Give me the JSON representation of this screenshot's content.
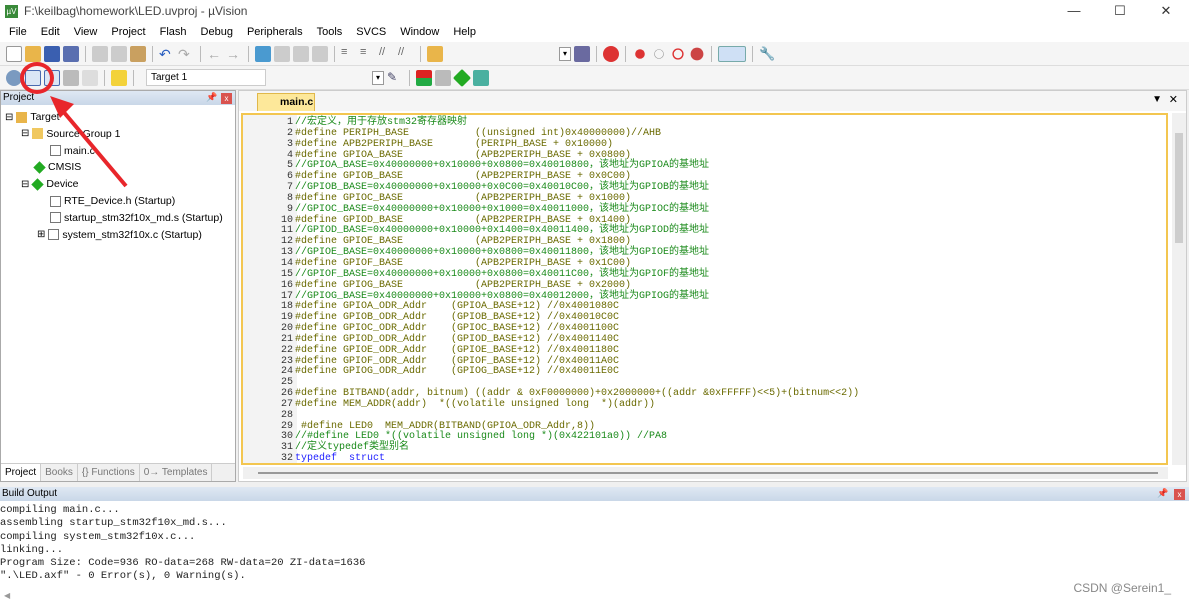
{
  "window": {
    "title": "F:\\keilbag\\homework\\LED.uvproj - µVision",
    "minimize": "—",
    "maximize": "☐",
    "close": "✕"
  },
  "menu": [
    "File",
    "Edit",
    "View",
    "Project",
    "Flash",
    "Debug",
    "Peripherals",
    "Tools",
    "SVCS",
    "Window",
    "Help"
  ],
  "toolbar2": {
    "target": "Target 1"
  },
  "project": {
    "title": "Project",
    "tree": [
      {
        "label": "Target",
        "level": 0,
        "icon": "target-icon"
      },
      {
        "label": "Source Group 1",
        "level": 1,
        "icon": "folder-icon"
      },
      {
        "label": "main.c",
        "level": 2,
        "icon": "file-icon"
      },
      {
        "label": "CMSIS",
        "level": 1,
        "icon": "diamond-icon"
      },
      {
        "label": "Device",
        "level": 1,
        "icon": "diamond-icon"
      },
      {
        "label": "RTE_Device.h (Startup)",
        "level": 2,
        "icon": "file-icon"
      },
      {
        "label": "startup_stm32f10x_md.s (Startup)",
        "level": 2,
        "icon": "file-icon"
      },
      {
        "label": "system_stm32f10x.c (Startup)",
        "level": 2,
        "icon": "file-icon"
      }
    ],
    "tabs": [
      "Project",
      "Books",
      "{} Functions",
      "0→ Templates"
    ]
  },
  "editor": {
    "tab": "main.c",
    "lines": [
      "//宏定义，用于存放stm32寄存器映射",
      "#define PERIPH_BASE           ((unsigned int)0x40000000)//AHB",
      "#define APB2PERIPH_BASE       (PERIPH_BASE + 0x10000)",
      "#define GPIOA_BASE            (APB2PERIPH_BASE + 0x0800)",
      "//GPIOA_BASE=0x40000000+0x10000+0x0800=0x40010800，该地址为GPIOA的基地址",
      "#define GPIOB_BASE            (APB2PERIPH_BASE + 0x0C00)",
      "//GPIOB_BASE=0x40000000+0x10000+0x0C00=0x40010C00，该地址为GPIOB的基地址",
      "#define GPIOC_BASE            (APB2PERIPH_BASE + 0x1000)",
      "//GPIOC_BASE=0x40000000+0x10000+0x1000=0x40011000，该地址为GPIOC的基地址",
      "#define GPIOD_BASE            (APB2PERIPH_BASE + 0x1400)",
      "//GPIOD_BASE=0x40000000+0x10000+0x1400=0x40011400，该地址为GPIOD的基地址",
      "#define GPIOE_BASE            (APB2PERIPH_BASE + 0x1800)",
      "//GPIOE_BASE=0x40000000+0x10000+0x0800=0x40011800，该地址为GPIOE的基地址",
      "#define GPIOF_BASE            (APB2PERIPH_BASE + 0x1C00)",
      "//GPIOF_BASE=0x40000000+0x10000+0x0800=0x40011C00，该地址为GPIOF的基地址",
      "#define GPIOG_BASE            (APB2PERIPH_BASE + 0x2000)",
      "//GPIOG_BASE=0x40000000+0x10000+0x0800=0x40012000，该地址为GPIOG的基地址",
      "#define GPIOA_ODR_Addr    (GPIOA_BASE+12) //0x4001080C",
      "#define GPIOB_ODR_Addr    (GPIOB_BASE+12) //0x40010C0C",
      "#define GPIOC_ODR_Addr    (GPIOC_BASE+12) //0x4001100C",
      "#define GPIOD_ODR_Addr    (GPIOD_BASE+12) //0x4001140C",
      "#define GPIOE_ODR_Addr    (GPIOE_BASE+12) //0x4001180C",
      "#define GPIOF_ODR_Addr    (GPIOF_BASE+12) //0x40011A0C",
      "#define GPIOG_ODR_Addr    (GPIOG_BASE+12) //0x40011E0C",
      "",
      "#define BITBAND(addr, bitnum) ((addr & 0xF0000000)+0x2000000+((addr &0xFFFFF)<<5)+(bitnum<<2))",
      "#define MEM_ADDR(addr)  *((volatile unsigned long  *)(addr))",
      "",
      " #define LED0  MEM_ADDR(BITBAND(GPIOA_ODR_Addr,8))",
      "//#define LED0 *((volatile unsigned long *)(0x422101a0)) //PA8",
      "//定义typedef类型别名",
      "typedef  struct"
    ]
  },
  "build": {
    "title": "Build Output",
    "lines": [
      "compiling main.c...",
      "assembling startup_stm32f10x_md.s...",
      "compiling system_stm32f10x.c...",
      "linking...",
      "Program Size: Code=936 RO-data=268 RW-data=20 ZI-data=1636",
      "\".\\LED.axf\" - 0 Error(s), 0 Warning(s)."
    ]
  },
  "watermark": "CSDN @Serein1_",
  "colors": {
    "annotation": "#e8262b",
    "comment": "#1a8a1a",
    "tab": "#fde89a"
  }
}
